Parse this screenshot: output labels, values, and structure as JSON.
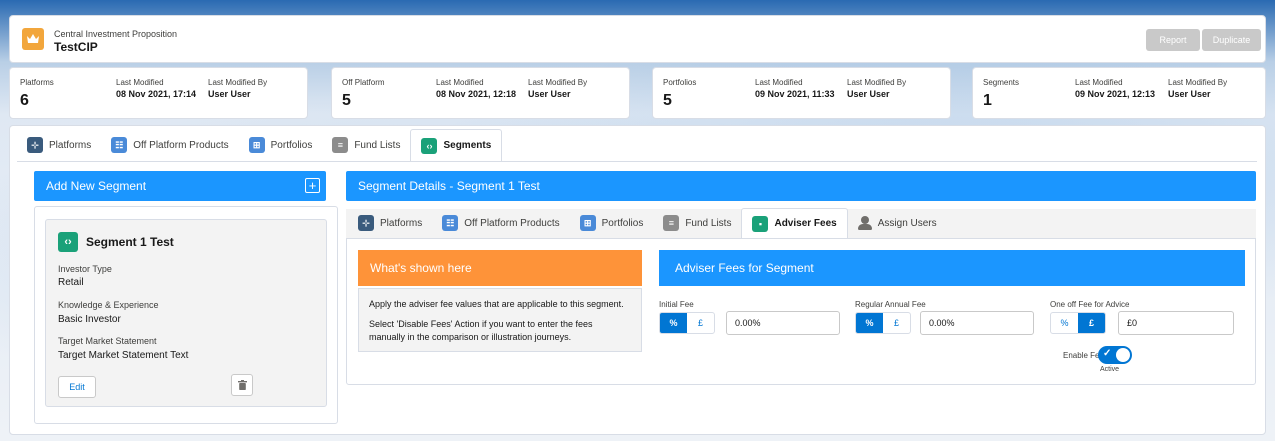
{
  "header": {
    "subtitle": "Central Investment Proposition",
    "title": "TestCIP",
    "report_label": "Report",
    "duplicate_label": "Duplicate"
  },
  "stats": [
    {
      "label": "Platforms",
      "value": "6",
      "modified_label": "Last Modified",
      "modified_value": "08 Nov 2021, 17:14",
      "by_label": "Last Modified By",
      "by_value": "User User"
    },
    {
      "label": "Off Platform",
      "value": "5",
      "modified_label": "Last Modified",
      "modified_value": "08 Nov 2021, 12:18",
      "by_label": "Last Modified By",
      "by_value": "User User"
    },
    {
      "label": "Portfolios",
      "value": "5",
      "modified_label": "Last Modified",
      "modified_value": "09 Nov 2021, 11:33",
      "by_label": "Last Modified By",
      "by_value": "User User"
    },
    {
      "label": "Segments",
      "value": "1",
      "modified_label": "Last Modified",
      "modified_value": "09 Nov 2021, 12:13",
      "by_label": "Last Modified By",
      "by_value": "User User"
    }
  ],
  "outer_tabs": [
    "Platforms",
    "Off Platform Products",
    "Portfolios",
    "Fund Lists",
    "Segments"
  ],
  "left": {
    "add_label": "Add New Segment",
    "segment": {
      "name": "Segment 1 Test",
      "investor_type_label": "Investor Type",
      "investor_type_value": "Retail",
      "knowledge_label": "Knowledge & Experience",
      "knowledge_value": "Basic Investor",
      "tms_label": "Target Market Statement",
      "tms_value": "Target Market Statement Text",
      "edit_label": "Edit"
    }
  },
  "details": {
    "title": "Segment Details - Segment 1 Test",
    "tabs": [
      "Platforms",
      "Off Platform Products",
      "Portfolios",
      "Fund Lists",
      "Adviser Fees",
      "Assign Users"
    ],
    "info": {
      "title": "What's shown here",
      "line1": "Apply the adviser fee values that are applicable to this segment.",
      "line2": "Select 'Disable Fees' Action if you want to enter the fees manually in the comparison or illustration journeys."
    },
    "fees": {
      "title": "Adviser Fees for Segment",
      "initial_label": "Initial Fee",
      "initial_value": "0.00%",
      "regular_label": "Regular Annual Fee",
      "regular_value": "0.00%",
      "oneoff_label": "One off Fee for Advice",
      "oneoff_value": "£0",
      "pct": "%",
      "gbp": "£",
      "enable_label": "Enable Fees",
      "active_label": "Active"
    }
  },
  "colors": {
    "accent_blue": "#1b96ff",
    "brand_blue": "#0176d3",
    "orange": "#fe9339",
    "header_icon": "#f2a63c",
    "segment_green": "#1aa179"
  },
  "icons": {
    "header": "crown-icon",
    "segments": "arrows-icon",
    "platforms": "platform-icon",
    "products": "table-icon",
    "portfolios": "portfolio-icon",
    "fund_lists": "list-icon",
    "adviser_fees": "money-icon",
    "assign_users": "user-icon",
    "add": "plus-icon",
    "delete": "trash-icon",
    "toggle": "check-icon"
  }
}
